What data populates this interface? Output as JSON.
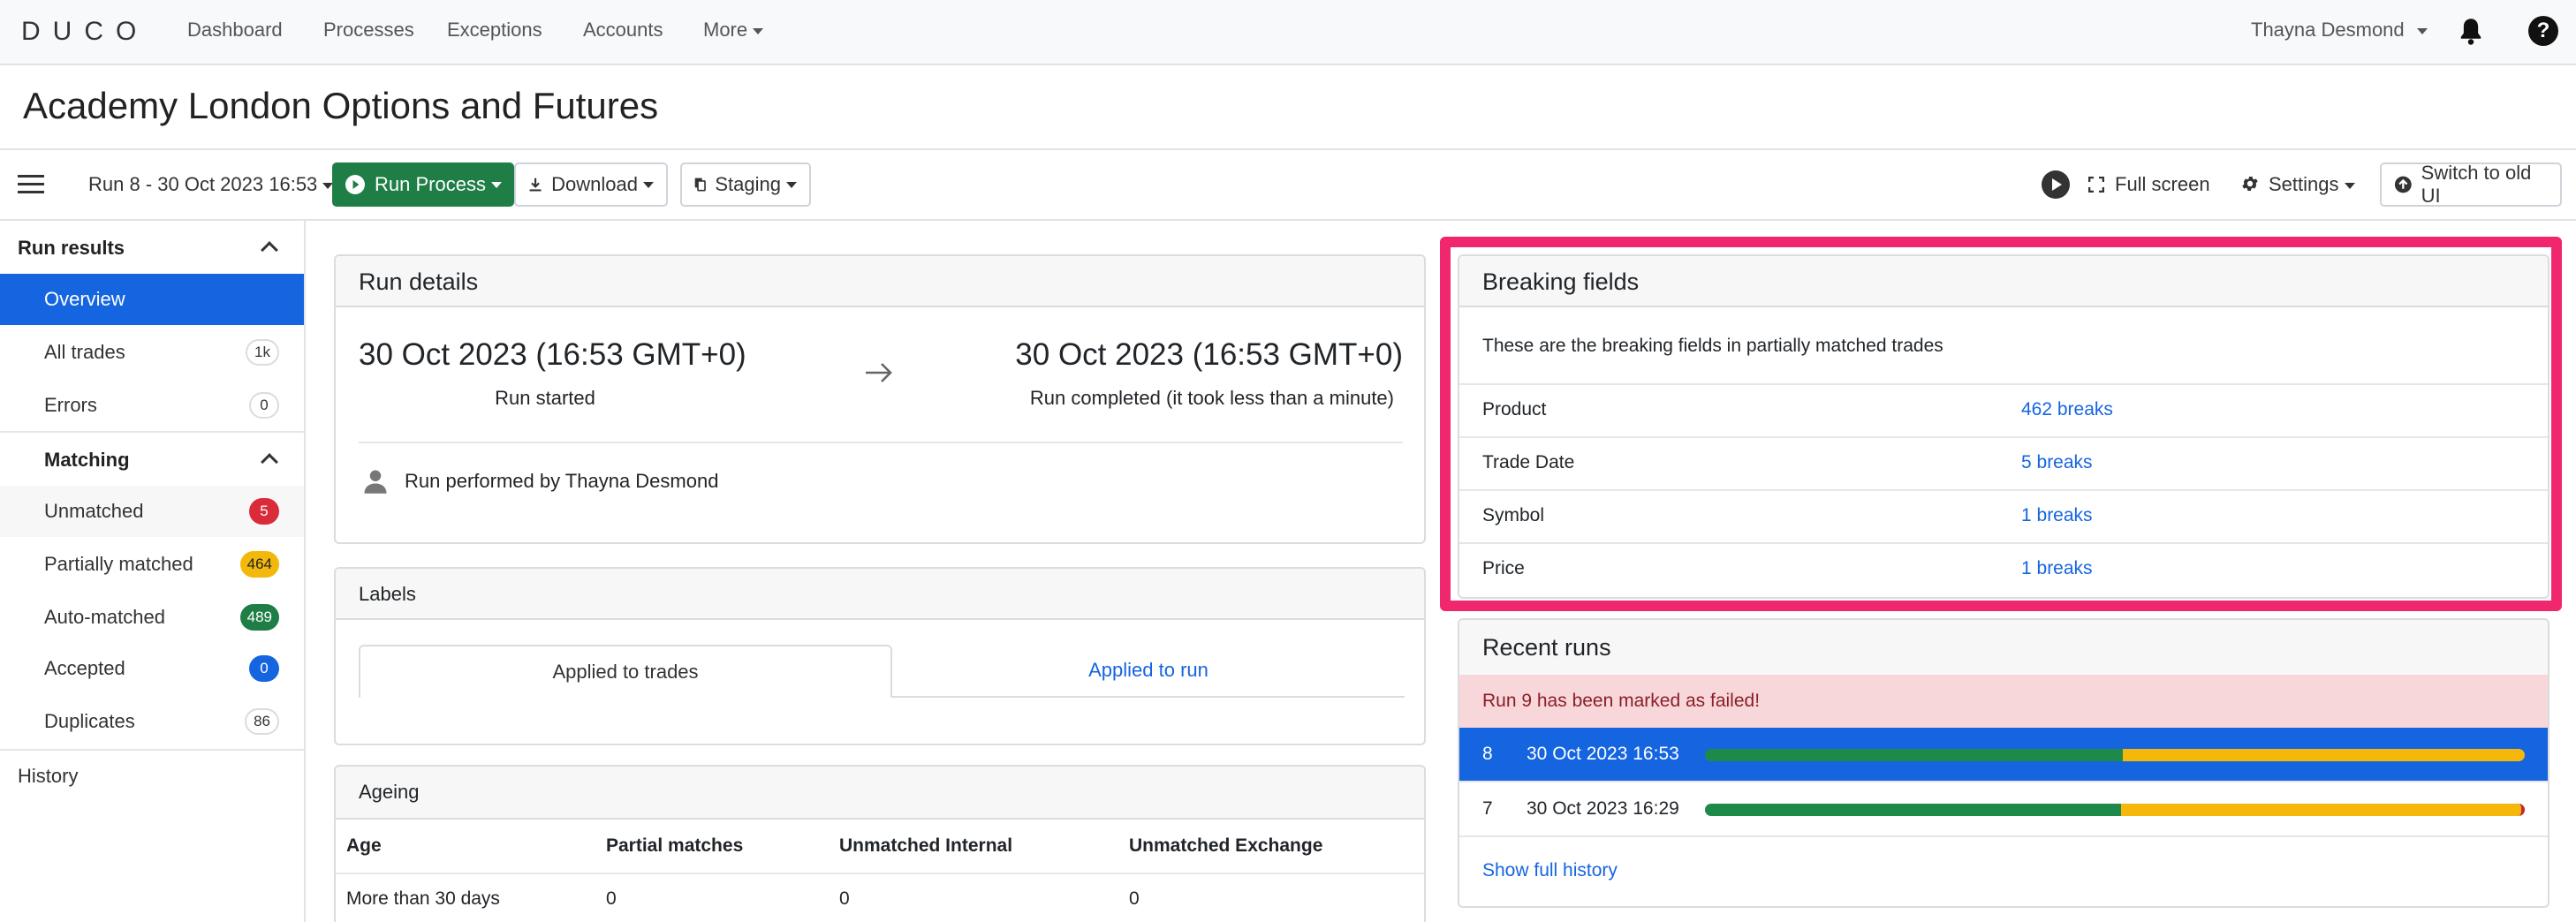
{
  "nav": {
    "logo": "DUCO",
    "links": [
      "Dashboard",
      "Processes",
      "Exceptions",
      "Accounts",
      "More"
    ],
    "user": "Thayna Desmond",
    "help": "?"
  },
  "page": {
    "title": "Academy London Options and Futures"
  },
  "toolbar": {
    "run_select": "Run 8 - 30 Oct 2023 16:53",
    "run_process": "Run Process",
    "download": "Download",
    "staging": "Staging",
    "full_screen": "Full screen",
    "settings": "Settings",
    "switch_old": "Switch to old UI"
  },
  "sidebar": {
    "run_results": "Run results",
    "overview": "Overview",
    "all_trades": {
      "label": "All trades",
      "count": "1k"
    },
    "errors": {
      "label": "Errors",
      "count": "0"
    },
    "matching": "Matching",
    "unmatched": {
      "label": "Unmatched",
      "count": "5"
    },
    "partially": {
      "label": "Partially matched",
      "count": "464"
    },
    "auto": {
      "label": "Auto-matched",
      "count": "489"
    },
    "accepted": {
      "label": "Accepted",
      "count": "0"
    },
    "duplicates": {
      "label": "Duplicates",
      "count": "86"
    },
    "history": "History"
  },
  "run_details": {
    "title": "Run details",
    "start_time": "30 Oct 2023 (16:53 GMT+0)",
    "start_label": "Run started",
    "end_time": "30 Oct 2023 (16:53 GMT+0)",
    "end_label": "Run completed (it took less than a minute)",
    "performed_by": "Run performed by Thayna Desmond"
  },
  "labels": {
    "title": "Labels",
    "tab_trades": "Applied to trades",
    "tab_run": "Applied to run"
  },
  "ageing": {
    "title": "Ageing",
    "columns": [
      "Age",
      "Partial matches",
      "Unmatched Internal",
      "Unmatched Exchange"
    ],
    "rows": [
      [
        "More than 30 days",
        "0",
        "0",
        "0"
      ]
    ]
  },
  "breaking": {
    "title": "Breaking fields",
    "description": "These are the breaking fields in partially matched trades",
    "rows": [
      {
        "field": "Product",
        "breaks": "462 breaks"
      },
      {
        "field": "Trade Date",
        "breaks": "5 breaks"
      },
      {
        "field": "Symbol",
        "breaks": "1 breaks"
      },
      {
        "field": "Price",
        "breaks": "1 breaks"
      }
    ]
  },
  "recent_runs": {
    "title": "Recent runs",
    "alert": "Run 9 has been marked as failed!",
    "runs": [
      {
        "number": "8",
        "date": "30 Oct 2023 16:53",
        "matched_fraction": 0.51,
        "partial_fraction": 0.49
      },
      {
        "number": "7",
        "date": "30 Oct 2023 16:29",
        "matched_fraction": 0.51,
        "partial_fraction": 0.49
      }
    ],
    "show_history": "Show full history"
  },
  "colors": {
    "accent_blue": "#1565e0",
    "green": "#1e7e45",
    "highlight": "#f0266f",
    "alert_bg": "#f8d7da"
  }
}
